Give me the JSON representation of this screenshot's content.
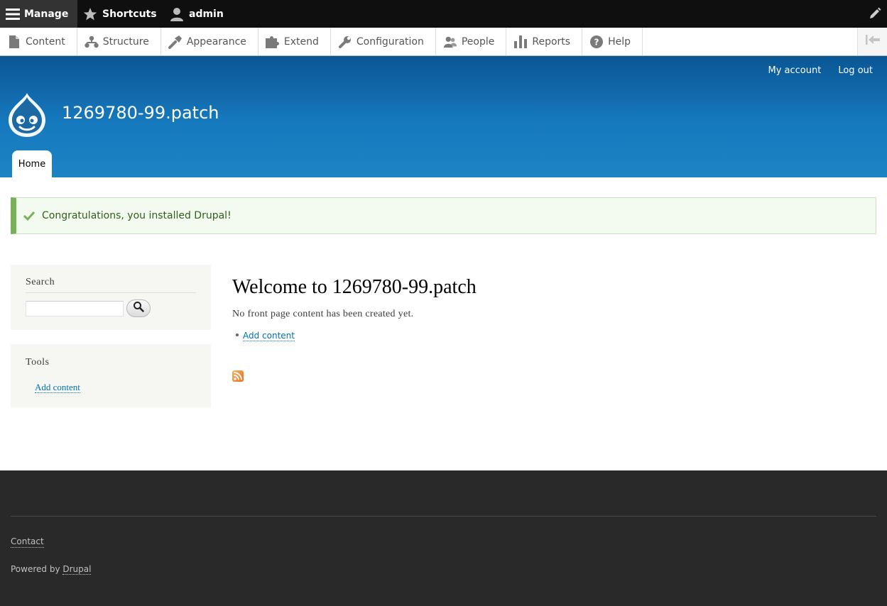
{
  "toolbar": {
    "manage_label": "Manage",
    "shortcuts_label": "Shortcuts",
    "user_label": "admin",
    "icons": [
      "menu-icon",
      "star-icon",
      "user-icon",
      "pencil-icon"
    ]
  },
  "tray": {
    "items": [
      {
        "label": "Content",
        "icon": "file-icon"
      },
      {
        "label": "Structure",
        "icon": "hierarchy-icon"
      },
      {
        "label": "Appearance",
        "icon": "brush-icon"
      },
      {
        "label": "Extend",
        "icon": "puzzle-icon"
      },
      {
        "label": "Configuration",
        "icon": "wrench-icon"
      },
      {
        "label": "People",
        "icon": "people-icon"
      },
      {
        "label": "Reports",
        "icon": "bar-chart-icon"
      },
      {
        "label": "Help",
        "icon": "help-icon"
      }
    ]
  },
  "header": {
    "my_account": "My account",
    "log_out": "Log out",
    "site_name": "1269780-99.patch",
    "tab_home": "Home"
  },
  "status": {
    "message": "Congratulations, you installed Drupal!"
  },
  "sidebar": {
    "search_title": "Search",
    "tools_title": "Tools",
    "tools_link": "Add content"
  },
  "main": {
    "title": "Welcome to 1269780-99.patch",
    "no_content": "No front page content has been created yet.",
    "add_content": "Add content"
  },
  "footer": {
    "contact": "Contact",
    "powered_prefix": "Powered by ",
    "powered_link": "Drupal"
  },
  "colors": {
    "header_top": "#0a5694",
    "header_bottom": "#1d84c3",
    "link": "#0071b3",
    "status_green": "#77b259",
    "footer_bg": "#292929"
  }
}
